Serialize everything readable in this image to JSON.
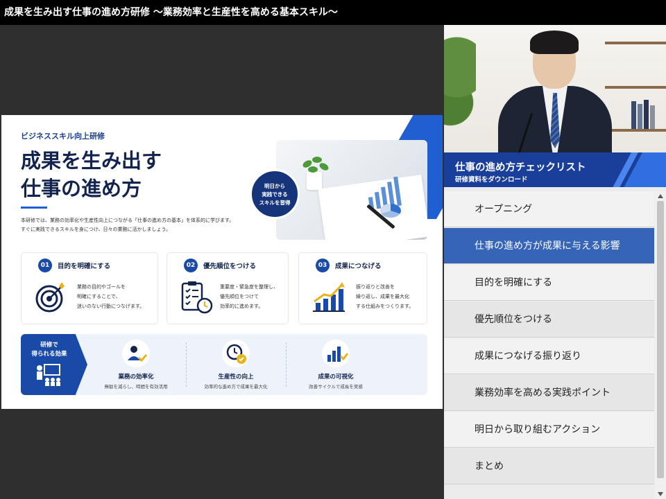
{
  "window": {
    "title": "成果を生み出す仕事の進め方研修 ～業務効率と生産性を高める基本スキル～"
  },
  "slide": {
    "eyebrow": "ビジネススキル向上研修",
    "title_line1": "成果を生み出す",
    "title_line2": "仕事の進め方",
    "intro_line1": "本研修では、業務の効率化や生産性向上につながる「仕事の進め方の基本」を体系的に学びます。",
    "intro_line2": "すぐに実践できるスキルを身につけ、日々の業務に活かしましょう。",
    "badge": [
      "明日から",
      "実践できる",
      "スキルを習得"
    ],
    "cards": [
      {
        "num": "01",
        "title": "目的を明確にする",
        "desc": [
          "業務の目的やゴールを",
          "明確にすることで、",
          "迷いのない行動につなげます。"
        ],
        "icon": "target-icon"
      },
      {
        "num": "02",
        "title": "優先順位をつける",
        "desc": [
          "重要度・緊急度を整理し、",
          "優先順位をつけて",
          "効率的に進めます。"
        ],
        "icon": "checklist-clock-icon"
      },
      {
        "num": "03",
        "title": "成果につなげる",
        "desc": [
          "振り返りと改善を",
          "繰り返し、成果を最大化",
          "する仕組みをつくります。"
        ],
        "icon": "growth-chart-icon"
      }
    ],
    "benefit": {
      "tag_line1": "研修で",
      "tag_line2": "得られる効果",
      "items": [
        {
          "title": "業務の効率化",
          "desc": "無駄を減らし、時間を有効活用",
          "icon": "person-check-icon"
        },
        {
          "title": "生産性の向上",
          "desc": "効率的な進め方で成果を最大化",
          "icon": "clock-check-icon"
        },
        {
          "title": "成果の可視化",
          "desc": "改善サイクルで成長を実感",
          "icon": "bar-check-icon"
        }
      ]
    }
  },
  "banner": {
    "title": "仕事の進め方チェックリスト",
    "subtitle": "研修資料をダウンロード"
  },
  "chapters": [
    {
      "label": "オープニング",
      "active": false
    },
    {
      "label": "仕事の進め方が成果に与える影響",
      "active": true
    },
    {
      "label": "目的を明確にする",
      "active": false
    },
    {
      "label": "優先順位をつける",
      "active": false
    },
    {
      "label": "成果につなげる振り返り",
      "active": false
    },
    {
      "label": "業務効率を高める実践ポイント",
      "active": false
    },
    {
      "label": "明日から取り組むアクション",
      "active": false
    },
    {
      "label": "まとめ",
      "active": false
    }
  ],
  "colors": {
    "accent": "#1a4aa8",
    "active_chapter": "#3665b8",
    "navy": "#12244e"
  }
}
